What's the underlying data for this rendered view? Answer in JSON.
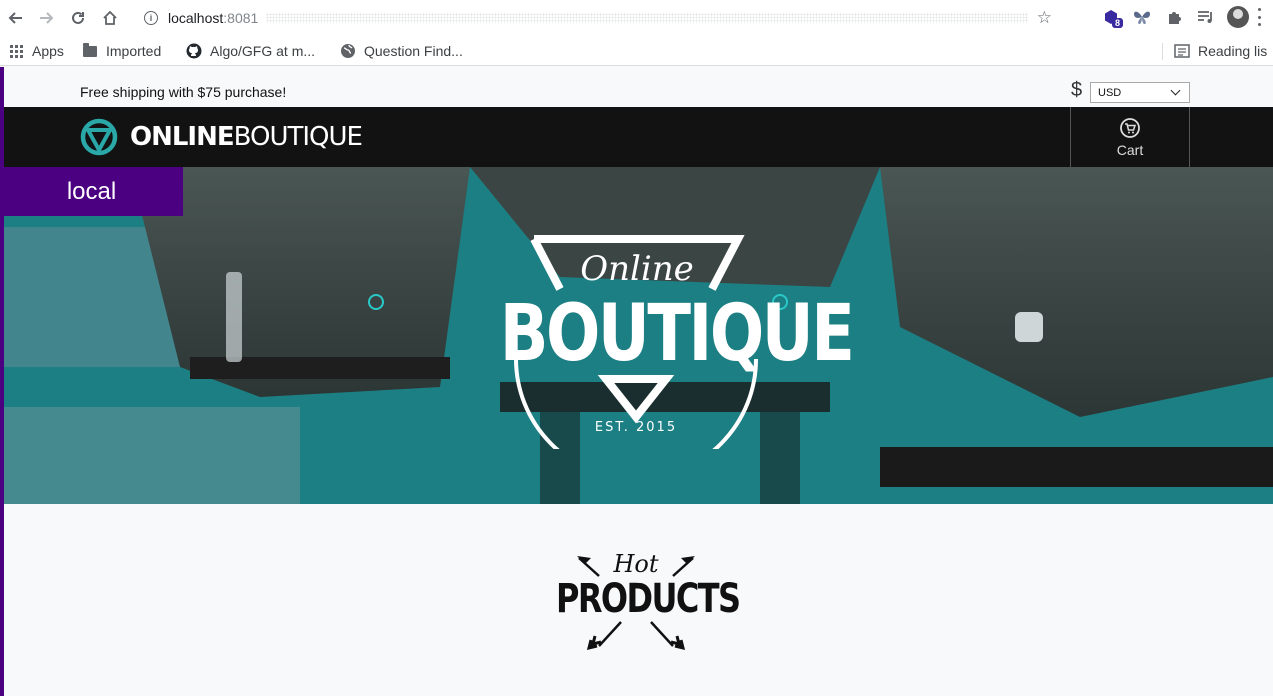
{
  "browser": {
    "url_host": "localhost",
    "url_port": ":8081",
    "extension_badge": "8",
    "bookmarks": [
      {
        "label": "Apps",
        "icon": "apps-icon"
      },
      {
        "label": "Imported",
        "icon": "folder-icon"
      },
      {
        "label": "Algo/GFG at m...",
        "icon": "github-icon"
      },
      {
        "label": "Question Find...",
        "icon": "globe-icon"
      }
    ],
    "reading_list": "Reading lis"
  },
  "page": {
    "shipping_text": "Free shipping with $75 purchase!",
    "currency_symbol": "$",
    "currency_value": "USD",
    "logo_bold": "ONLINE",
    "logo_light": "BOUTIQUE",
    "cart_label": "Cart",
    "env_badge": "local",
    "hero_script": "Online",
    "hero_title": "BOUTIQUE",
    "hero_est": "EST. 2015",
    "hot_script": "Hot",
    "hot_title": "PRODUCTS"
  },
  "colors": {
    "accent_purple": "#4b0082",
    "header_bg": "#121212",
    "logo_teal": "#2aa8a8",
    "hero_teal": "#1f8f93"
  }
}
